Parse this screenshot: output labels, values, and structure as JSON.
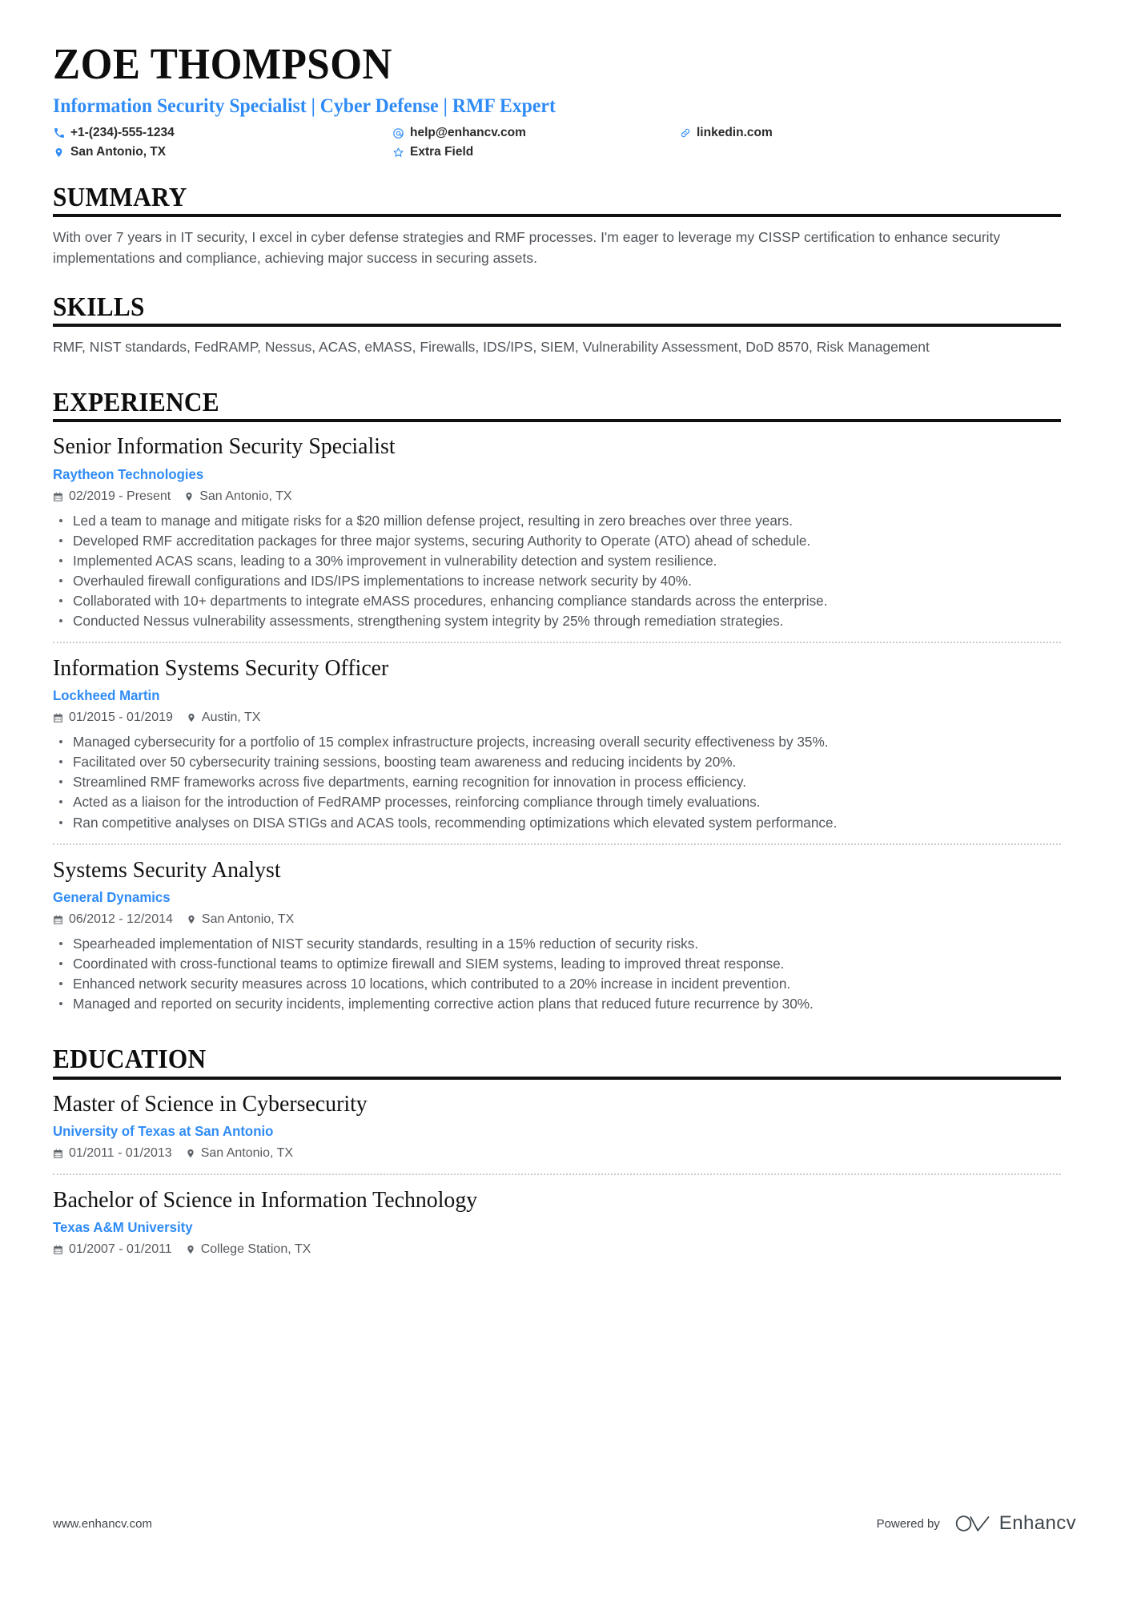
{
  "header": {
    "name": "ZOE THOMPSON",
    "headline": "Information Security Specialist | Cyber Defense | RMF Expert",
    "contacts": [
      {
        "icon": "phone-icon",
        "text": "+1-(234)-555-1234"
      },
      {
        "icon": "email-icon",
        "text": "help@enhancv.com"
      },
      {
        "icon": "link-icon",
        "text": "linkedin.com"
      },
      {
        "icon": "location-icon",
        "text": "San Antonio, TX"
      },
      {
        "icon": "star-icon",
        "text": "Extra Field"
      }
    ]
  },
  "summary": {
    "title": "SUMMARY",
    "text": "With over 7 years in IT security, I excel in cyber defense strategies and RMF processes. I'm eager to leverage my CISSP certification to enhance security implementations and compliance, achieving major success in securing assets."
  },
  "skills": {
    "title": "SKILLS",
    "text": "RMF, NIST standards, FedRAMP, Nessus, ACAS, eMASS, Firewalls, IDS/IPS, SIEM, Vulnerability Assessment, DoD 8570, Risk Management"
  },
  "experience": {
    "title": "EXPERIENCE",
    "entries": [
      {
        "title": "Senior Information Security Specialist",
        "org": "Raytheon Technologies",
        "dates": "02/2019 - Present",
        "location": "San Antonio, TX",
        "bullets": [
          "Led a team to manage and mitigate risks for a $20 million defense project, resulting in zero breaches over three years.",
          "Developed RMF accreditation packages for three major systems, securing Authority to Operate (ATO) ahead of schedule.",
          "Implemented ACAS scans, leading to a 30% improvement in vulnerability detection and system resilience.",
          "Overhauled firewall configurations and IDS/IPS implementations to increase network security by 40%.",
          "Collaborated with 10+ departments to integrate eMASS procedures, enhancing compliance standards across the enterprise.",
          "Conducted Nessus vulnerability assessments, strengthening system integrity by 25% through remediation strategies."
        ]
      },
      {
        "title": "Information Systems Security Officer",
        "org": "Lockheed Martin",
        "dates": "01/2015 - 01/2019",
        "location": "Austin, TX",
        "bullets": [
          "Managed cybersecurity for a portfolio of 15 complex infrastructure projects, increasing overall security effectiveness by 35%.",
          "Facilitated over 50 cybersecurity training sessions, boosting team awareness and reducing incidents by 20%.",
          "Streamlined RMF frameworks across five departments, earning recognition for innovation in process efficiency.",
          "Acted as a liaison for the introduction of FedRAMP processes, reinforcing compliance through timely evaluations.",
          "Ran competitive analyses on DISA STIGs and ACAS tools, recommending optimizations which elevated system performance."
        ]
      },
      {
        "title": "Systems Security Analyst",
        "org": "General Dynamics",
        "dates": "06/2012 - 12/2014",
        "location": "San Antonio, TX",
        "bullets": [
          "Spearheaded implementation of NIST security standards, resulting in a 15% reduction of security risks.",
          "Coordinated with cross-functional teams to optimize firewall and SIEM systems, leading to improved threat response.",
          "Enhanced network security measures across 10 locations, which contributed to a 20% increase in incident prevention.",
          "Managed and reported on security incidents, implementing corrective action plans that reduced future recurrence by 30%."
        ]
      }
    ]
  },
  "education": {
    "title": "EDUCATION",
    "entries": [
      {
        "title": "Master of Science in Cybersecurity",
        "org": "University of Texas at San Antonio",
        "dates": "01/2011 - 01/2013",
        "location": "San Antonio, TX"
      },
      {
        "title": "Bachelor of Science in Information Technology",
        "org": "Texas A&M University",
        "dates": "01/2007 - 01/2011",
        "location": "College Station, TX"
      }
    ]
  },
  "footer": {
    "website": "www.enhancv.com",
    "powered_by": "Powered by",
    "brand": "Enhancv"
  },
  "colors": {
    "accent": "#2f8bf5",
    "heading": "#0d0d0d",
    "body": "#50555a",
    "rule": "#111111"
  }
}
